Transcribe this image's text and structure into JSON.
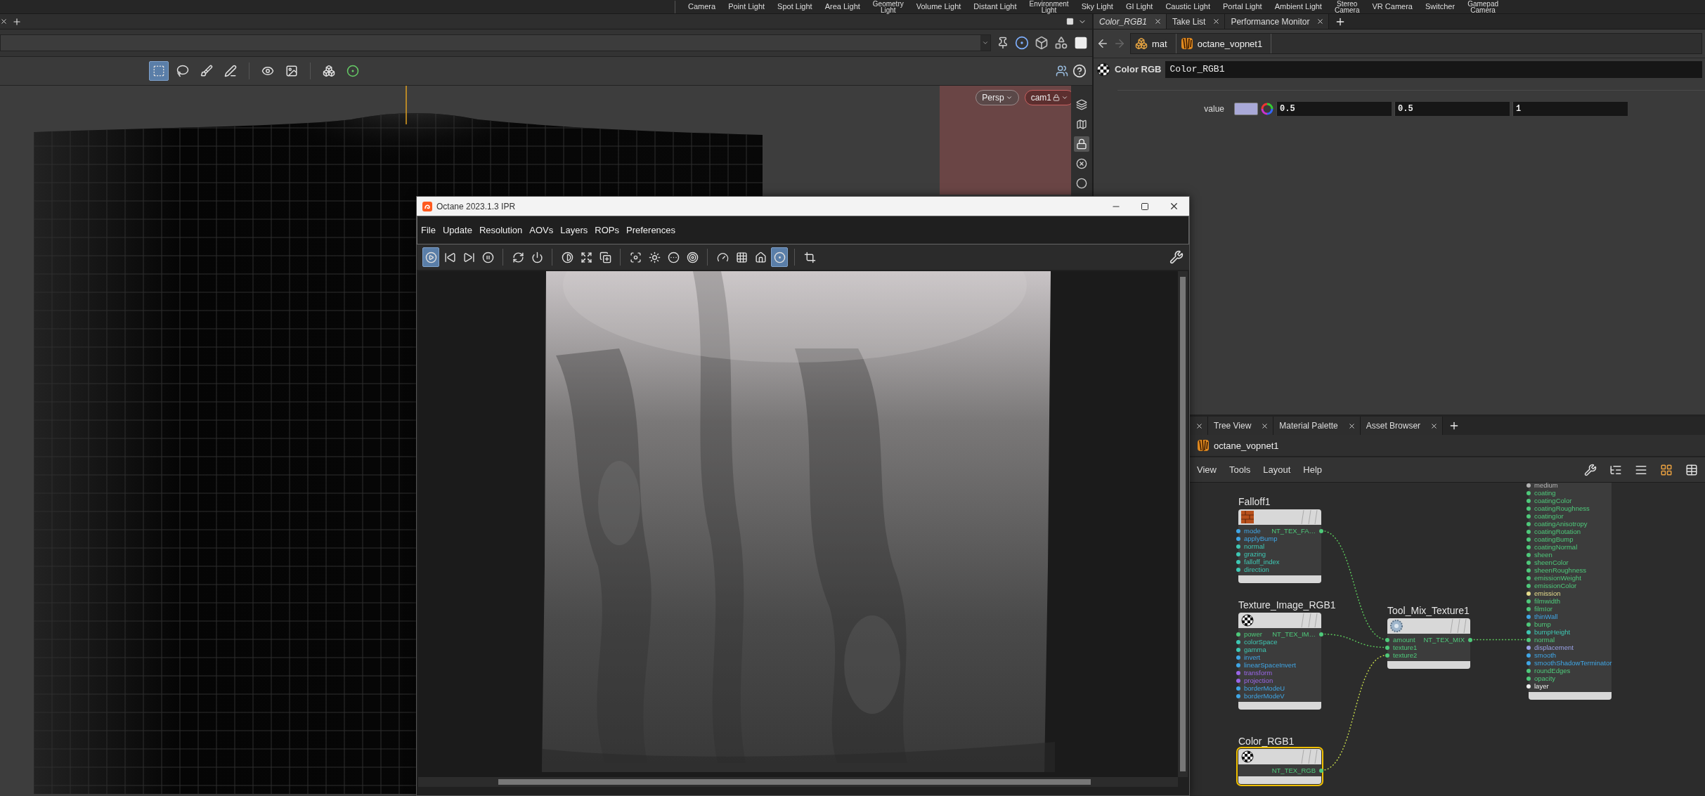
{
  "shelf": {
    "tools": [
      {
        "label": "Camera"
      },
      {
        "label": "Point Light"
      },
      {
        "label": "Spot Light"
      },
      {
        "label": "Area Light"
      },
      {
        "label": "Geometry Light"
      },
      {
        "label": "Volume Light"
      },
      {
        "label": "Distant Light"
      },
      {
        "label": "Environment Light"
      },
      {
        "label": "Sky Light"
      },
      {
        "label": "GI Light"
      },
      {
        "label": "Caustic Light"
      },
      {
        "label": "Portal Light"
      },
      {
        "label": "Ambient Light"
      },
      {
        "label": "Stereo Camera"
      },
      {
        "label": "VR Camera"
      },
      {
        "label": "Switcher"
      },
      {
        "label": "Gamepad Camera"
      }
    ]
  },
  "viewport": {
    "tools": [
      {
        "selected": true
      },
      {
        "selected": false
      },
      {
        "selected": false
      },
      {
        "selected": false
      },
      {
        "selected": false
      },
      {
        "selected": false
      },
      {
        "selected": false
      },
      {
        "selected": false
      }
    ],
    "camera_buttons": [
      {
        "label": "Persp"
      },
      {
        "label": "cam1"
      }
    ]
  },
  "parameter_pane": {
    "tabs": [
      {
        "label": "Color_RGB1",
        "selected": true
      },
      {
        "label": "Take List",
        "selected": false
      },
      {
        "label": "Performance Monitor",
        "selected": false
      }
    ],
    "path": [
      "mat",
      "octane_vopnet1"
    ],
    "node_type": "Color RGB",
    "node_name": "Color_RGB1",
    "parameters": [
      {
        "label": "value",
        "color": "#a9a9d8",
        "values": [
          "0.5",
          "0.5",
          "1"
        ]
      }
    ]
  },
  "octane": {
    "title": "Octane 2023.1.3 IPR",
    "menu": [
      "File",
      "Update",
      "Resolution",
      "AOVs",
      "Layers",
      "ROPs",
      "Preferences"
    ],
    "toolbar": [
      [
        {
          "selected": true
        },
        {
          "selected": false
        },
        {
          "selected": false
        },
        {
          "selected": false
        }
      ],
      [
        {
          "selected": false
        },
        {
          "selected": false
        }
      ],
      [
        {
          "selected": false
        },
        {
          "selected": false
        },
        {
          "selected": false
        }
      ],
      [
        {
          "selected": false
        },
        {
          "selected": false
        },
        {
          "selected": false
        },
        {
          "selected": false
        }
      ],
      [
        {
          "selected": false
        },
        {
          "selected": false
        },
        {
          "selected": false
        },
        {
          "selected": true
        }
      ],
      [
        {
          "selected": false
        }
      ]
    ]
  },
  "network_pane": {
    "tabs": [
      {
        "label": "Tree View"
      },
      {
        "label": "Material Palette"
      },
      {
        "label": "Asset Browser"
      }
    ],
    "path": "octane_vopnet1",
    "menu": [
      "View",
      "Tools",
      "Layout",
      "Help"
    ],
    "nodes": [
      {
        "kind": "texture",
        "title": "Falloff1",
        "selected": false,
        "output": "NT_TEX_FA…",
        "inputs": [
          {
            "name": "mode",
            "color": "#3fa6e6"
          },
          {
            "name": "applyBump",
            "color": "#3fa6e6"
          },
          {
            "name": "normal",
            "color": "#3ec8b4"
          },
          {
            "name": "grazing",
            "color": "#3ec8b4"
          },
          {
            "name": "falloff_index",
            "color": "#3ec8b4"
          },
          {
            "name": "direction",
            "color": "#3ec8b4"
          }
        ]
      },
      {
        "kind": "texture",
        "title": "Texture_Image_RGB1",
        "selected": false,
        "output": "NT_TEX_IM…",
        "inputs": [
          {
            "name": "power",
            "color": "#4ec97a"
          },
          {
            "name": "colorSpace",
            "color": "#3ec8b4"
          },
          {
            "name": "gamma",
            "color": "#3ec8b4"
          },
          {
            "name": "invert",
            "color": "#3fa6e6"
          },
          {
            "name": "linearSpaceInvert",
            "color": "#3fa6e6"
          },
          {
            "name": "transform",
            "color": "#9a66e8"
          },
          {
            "name": "projection",
            "color": "#9a66e8"
          },
          {
            "name": "borderModeU",
            "color": "#3fa6e6"
          },
          {
            "name": "borderModeV",
            "color": "#3fa6e6"
          }
        ]
      },
      {
        "kind": "texture",
        "title": "Color_RGB1",
        "selected": true,
        "output": "NT_TEX_RGB"
      },
      {
        "kind": "texture",
        "title": "Tool_Mix_Texture1",
        "selected": false,
        "output": "NT_TEX_MIX",
        "inputs": [
          {
            "name": "amount",
            "color": "#4ec97a"
          },
          {
            "name": "texture1",
            "color": "#4ec97a"
          },
          {
            "name": "texture2",
            "color": "#4ec97a"
          }
        ]
      },
      {
        "kind": "output",
        "inputs": [
          {
            "name": "medium",
            "color": "#b4b4b4"
          },
          {
            "name": "coating",
            "color": "#4ec97a"
          },
          {
            "name": "coatingColor",
            "color": "#4ec97a"
          },
          {
            "name": "coatingRoughness",
            "color": "#4ec97a"
          },
          {
            "name": "coatingIor",
            "color": "#4ec97a"
          },
          {
            "name": "coatingAnisotropy",
            "color": "#4ec97a"
          },
          {
            "name": "coatingRotation",
            "color": "#4ec97a"
          },
          {
            "name": "coatingBump",
            "color": "#4ec97a"
          },
          {
            "name": "coatingNormal",
            "color": "#4ec97a"
          },
          {
            "name": "sheen",
            "color": "#4ec97a"
          },
          {
            "name": "sheenColor",
            "color": "#4ec97a"
          },
          {
            "name": "sheenRoughness",
            "color": "#4ec97a"
          },
          {
            "name": "emissionWeight",
            "color": "#4ec97a"
          },
          {
            "name": "emissionColor",
            "color": "#4ec97a"
          },
          {
            "name": "emission",
            "color": "#e6dc8c"
          },
          {
            "name": "filmwidth",
            "color": "#4ec97a"
          },
          {
            "name": "filmIor",
            "color": "#4ec97a"
          },
          {
            "name": "thinWall",
            "color": "#3fa6e6"
          },
          {
            "name": "bump",
            "color": "#4ec97a"
          },
          {
            "name": "bumpHeight",
            "color": "#3ec8b4"
          },
          {
            "name": "normal",
            "color": "#4ec97a"
          },
          {
            "name": "displacement",
            "color": "#9aa2e6"
          },
          {
            "name": "smooth",
            "color": "#3fa6e6"
          },
          {
            "name": "smoothShadowTerminator",
            "color": "#3fa6e6"
          },
          {
            "name": "roundEdges",
            "color": "#4ec97a"
          },
          {
            "name": "opacity",
            "color": "#4ec97a"
          },
          {
            "name": "layer",
            "color": "#eeeeee"
          }
        ]
      }
    ]
  }
}
